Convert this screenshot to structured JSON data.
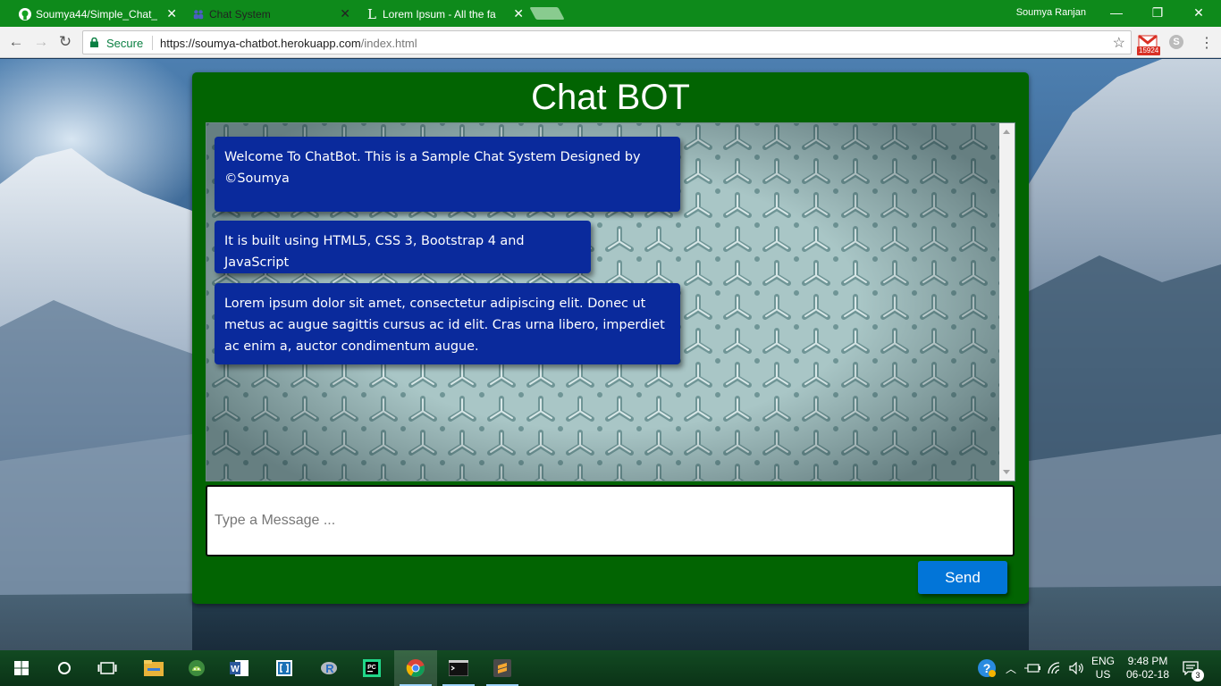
{
  "browser": {
    "tabs": [
      {
        "label": "Soumya44/Simple_Chat_",
        "icon": "github-icon",
        "active": false
      },
      {
        "label": "Chat System",
        "icon": "teams-icon",
        "active": true
      },
      {
        "label": "Lorem Ipsum - All the fa",
        "icon": "lorem-l-icon",
        "active": false
      }
    ],
    "profile_name": "Soumya Ranjan",
    "window_controls": {
      "minimize": "—",
      "restore": "❐",
      "close": "✕"
    },
    "address": {
      "secure_label": "Secure",
      "url_host": "https://soumya-chatbot.herokuapp.com",
      "url_path": "/index.html"
    },
    "extensions": {
      "gmail_count": "15924",
      "skype_glyph": "S"
    },
    "colors": {
      "titlebar": "#0e8a1b",
      "secure": "#0b8043"
    }
  },
  "chat": {
    "title": "Chat BOT",
    "messages": [
      {
        "text": "Welcome To ChatBot. This is a Sample Chat System Designed by ©Soumya"
      },
      {
        "text": "It is built using HTML5, CSS 3, Bootstrap 4 and JavaScript"
      },
      {
        "text": "Lorem ipsum dolor sit amet, consectetur adipiscing elit. Donec ut metus ac augue sagittis cursus ac id elit. Cras urna libero, imperdiet ac enim a, auctor condimentum augue."
      }
    ],
    "input_placeholder": "Type a Message ...",
    "input_value": "",
    "send_label": "Send",
    "colors": {
      "card": "#026402",
      "bubble": "#0a2a9c",
      "send": "#0275d8"
    }
  },
  "taskbar": {
    "apps": [
      {
        "name": "start-icon",
        "running": false
      },
      {
        "name": "cortana-icon",
        "running": false
      },
      {
        "name": "task-view-icon",
        "running": false
      },
      {
        "name": "file-explorer-icon",
        "running": false
      },
      {
        "name": "android-studio-icon",
        "running": false
      },
      {
        "name": "word-icon",
        "running": false
      },
      {
        "name": "brackets-icon",
        "running": false
      },
      {
        "name": "r-icon",
        "running": false
      },
      {
        "name": "pycharm-icon",
        "running": false
      },
      {
        "name": "chrome-icon",
        "running": true
      },
      {
        "name": "terminal-icon",
        "running": true
      },
      {
        "name": "sublime-icon",
        "running": true
      }
    ],
    "lang_line1": "ENG",
    "lang_line2": "US",
    "time": "9:48 PM",
    "date": "06-02-18",
    "notifications": "3"
  }
}
